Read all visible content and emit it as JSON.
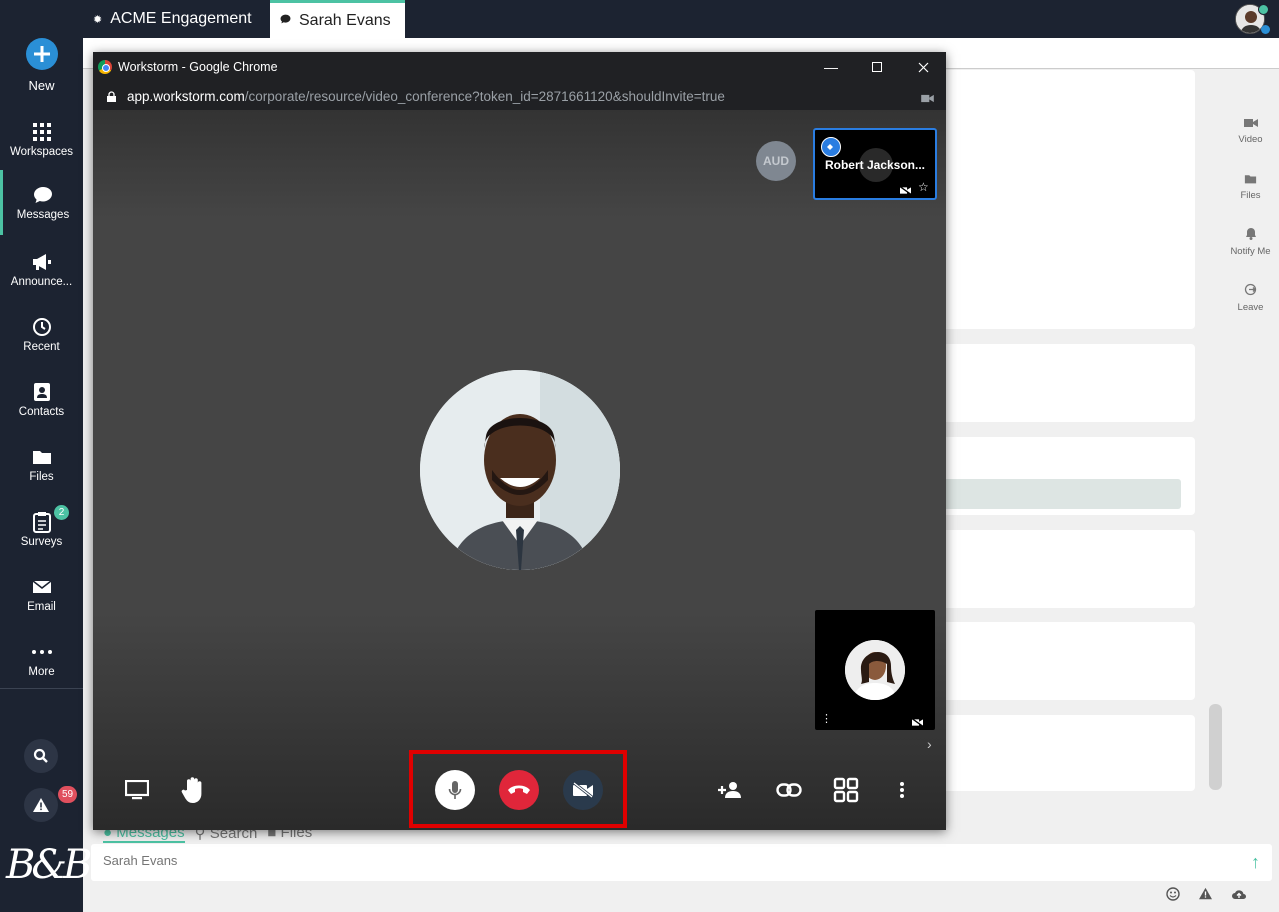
{
  "sidebar": {
    "new_label": "New",
    "items": [
      {
        "label": "Workspaces",
        "icon": "grid-icon"
      },
      {
        "label": "Messages",
        "icon": "chat-icon"
      },
      {
        "label": "Announce...",
        "icon": "megaphone-icon"
      },
      {
        "label": "Recent",
        "icon": "history-icon"
      },
      {
        "label": "Contacts",
        "icon": "contacts-icon"
      },
      {
        "label": "Files",
        "icon": "folder-icon"
      },
      {
        "label": "Surveys",
        "icon": "clipboard-icon",
        "badge": "2"
      },
      {
        "label": "Email",
        "icon": "mail-icon"
      },
      {
        "label": "More",
        "icon": "more-icon"
      }
    ],
    "alert_badge": "59",
    "logo_text": "B&B"
  },
  "tabs": [
    {
      "label": "ACME Engagement"
    },
    {
      "label": "Sarah Evans"
    }
  ],
  "popup": {
    "window_title": "Workstorm - Google Chrome",
    "url_host": "app.workstorm.com",
    "url_path": "/corporate/resource/video_conference?token_id=2871661120&shouldInvite=true"
  },
  "call": {
    "aud_label": "AUD",
    "pinned_participant": "Robert Jackson..."
  },
  "right_panel": [
    {
      "label": "Video",
      "icon": "video-icon"
    },
    {
      "label": "Files",
      "icon": "folder-icon"
    },
    {
      "label": "Notify Me",
      "icon": "bell-icon"
    },
    {
      "label": "Leave",
      "icon": "leave-icon"
    }
  ],
  "bottom_tabs": {
    "messages": "Messages",
    "search": "Search",
    "files": "Files"
  },
  "compose": {
    "placeholder": "Sarah Evans"
  },
  "colors": {
    "sidebar_bg": "#1c2331",
    "accent": "#4cc2a3",
    "end_call": "#e0263a",
    "highlight": "#e00000"
  }
}
